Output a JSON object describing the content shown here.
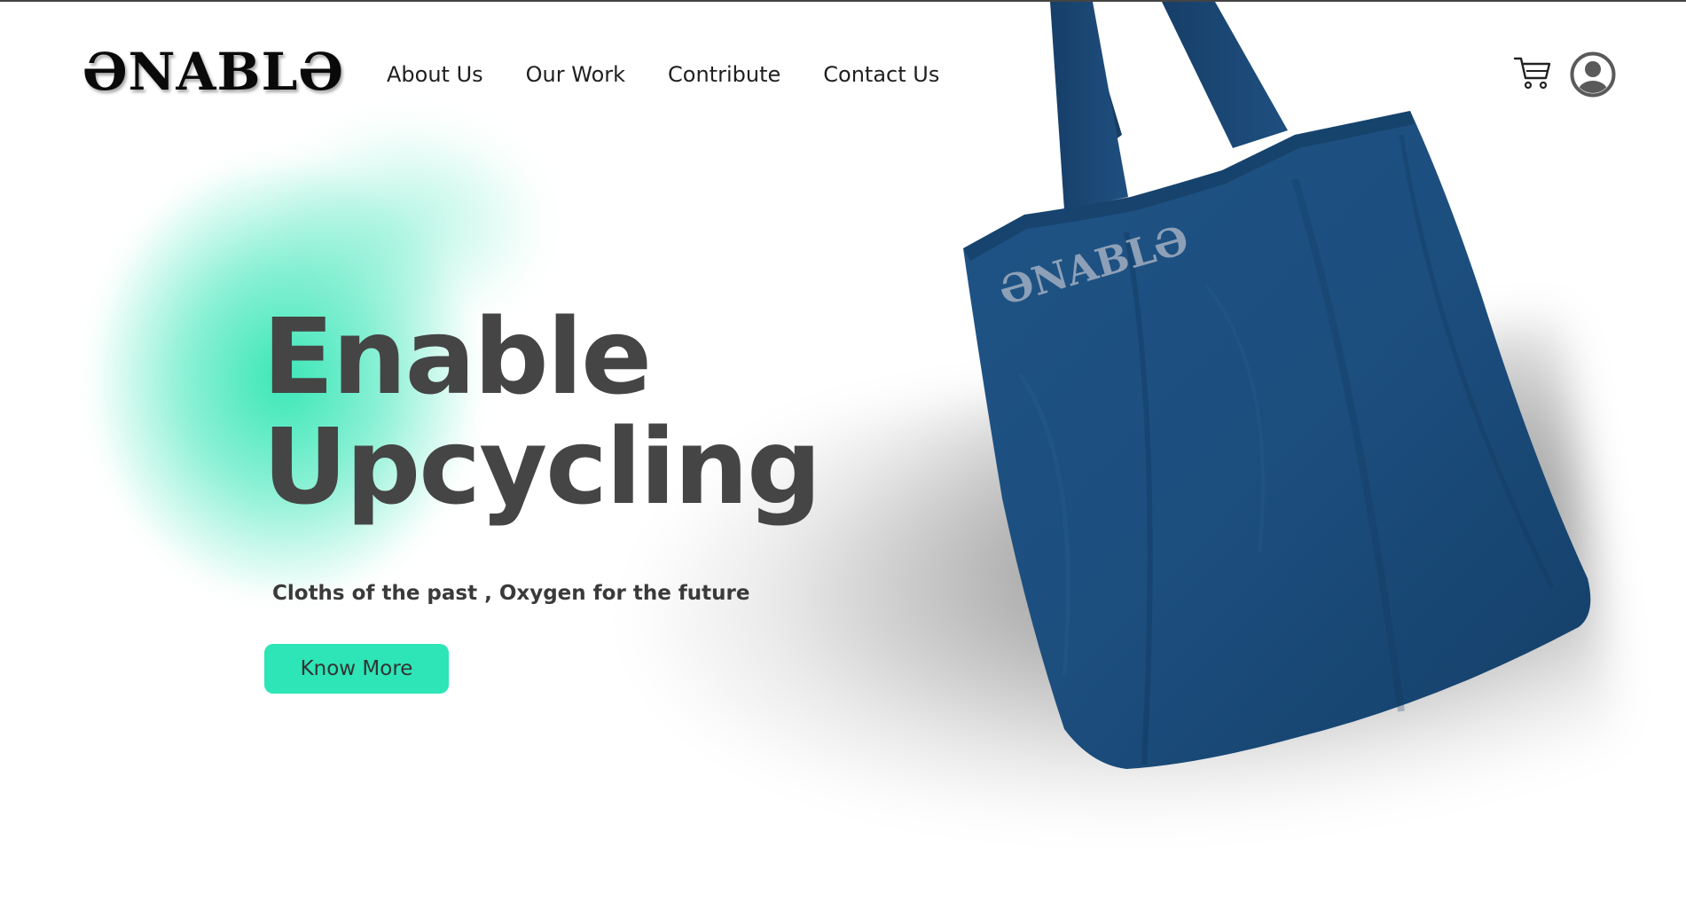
{
  "brand": {
    "logo_text": "ƏNABLƏ"
  },
  "nav": {
    "items": [
      {
        "label": "About Us"
      },
      {
        "label": "Our Work"
      },
      {
        "label": "Contribute"
      },
      {
        "label": "Contact Us"
      }
    ]
  },
  "header_icons": {
    "cart": "cart-icon",
    "user": "user-account-icon"
  },
  "hero": {
    "title_line1": "Enable",
    "title_line2": "Upcycling",
    "tagline": "Cloths of the past , Oxygen for the future",
    "cta_label": "Know More"
  },
  "product_image": {
    "subject": "tote-bag",
    "print_text": "ƏNABLƏ"
  },
  "colors": {
    "accent": "#2de5b6",
    "title": "#454545",
    "bag": "#1d4f7f",
    "text": "#1f1f1f"
  }
}
